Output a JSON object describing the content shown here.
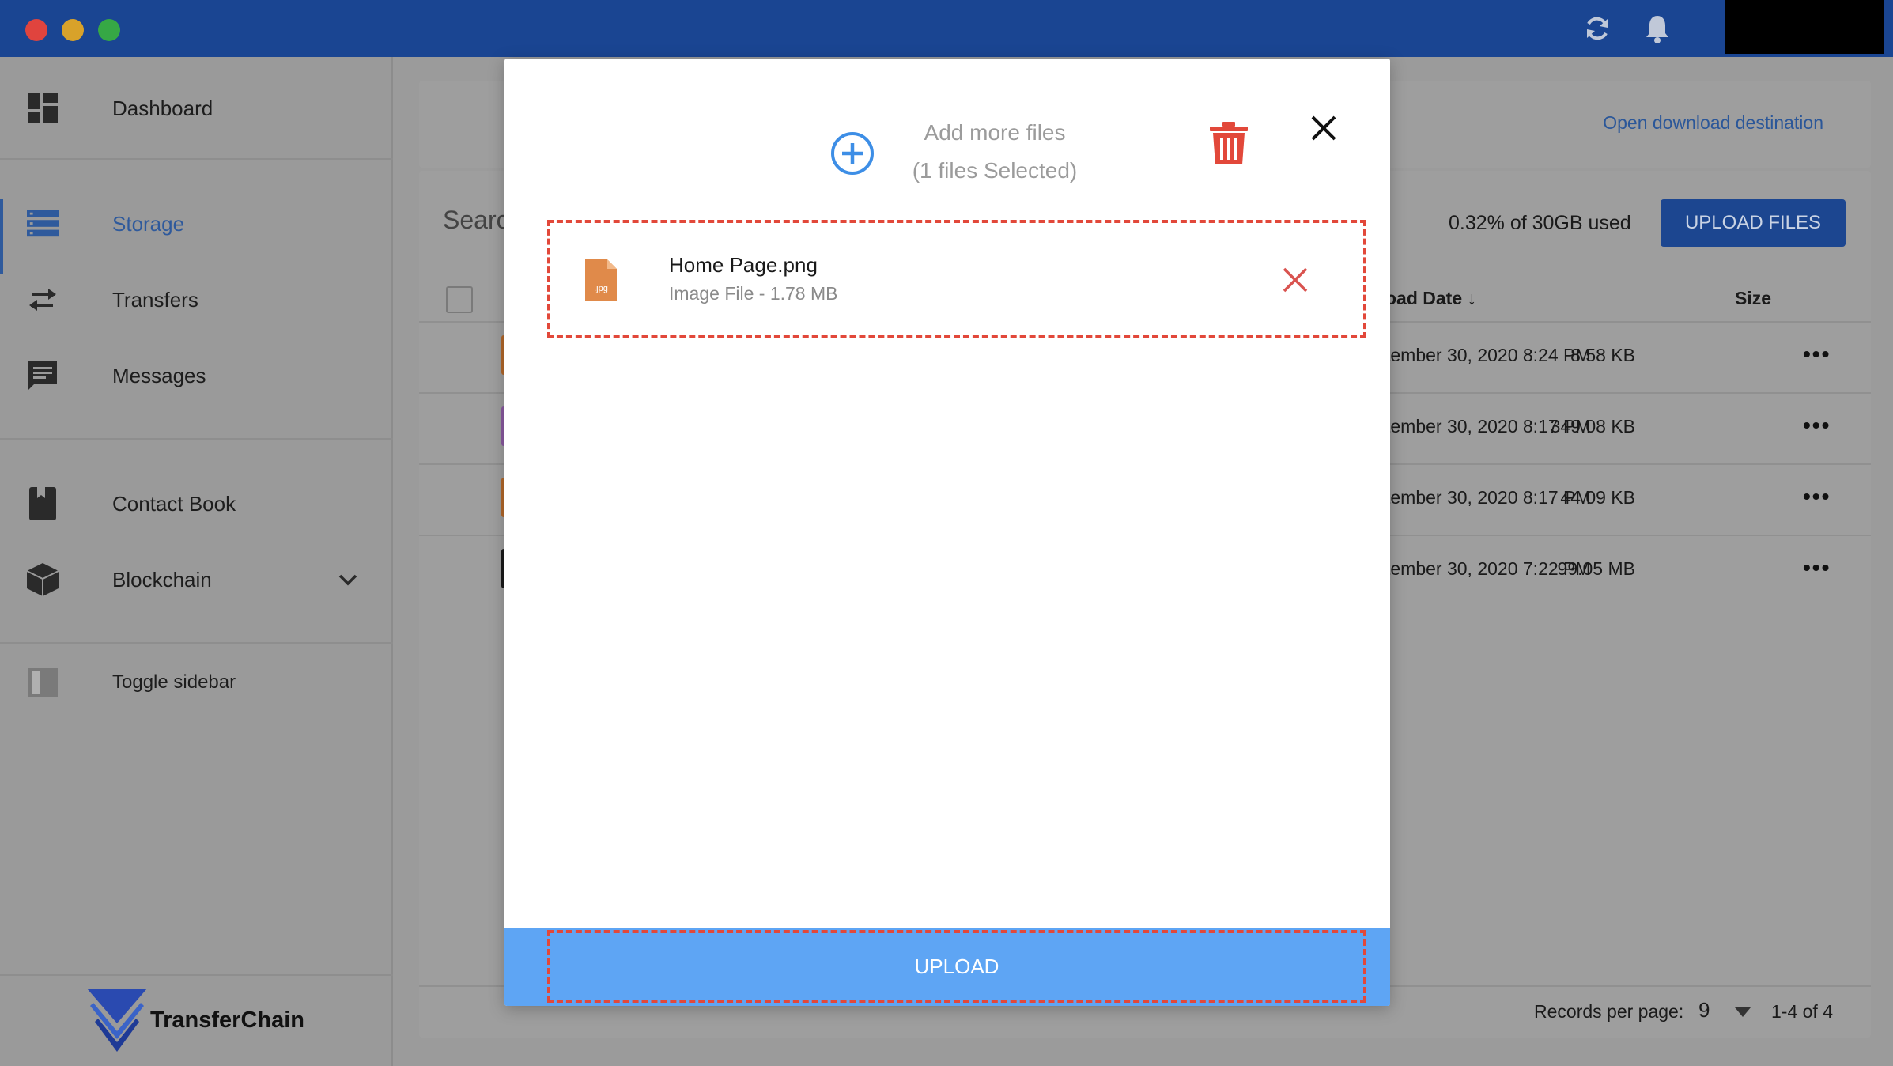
{
  "titlebar": {
    "icons": [
      "refresh-icon",
      "bell-icon"
    ]
  },
  "sidebar": {
    "items": [
      {
        "label": "Dashboard",
        "icon": "dashboard-icon"
      },
      {
        "label": "Storage",
        "icon": "storage-icon",
        "active": true
      },
      {
        "label": "Transfers",
        "icon": "transfers-icon"
      },
      {
        "label": "Messages",
        "icon": "messages-icon"
      },
      {
        "label": "Contact Book",
        "icon": "book-icon"
      },
      {
        "label": "Blockchain",
        "icon": "blockchain-icon"
      },
      {
        "label": "Toggle sidebar",
        "icon": "toggle-sidebar-icon"
      }
    ],
    "brand": "TransferChain"
  },
  "main": {
    "open_download_destination": "Open download destination",
    "search_placeholder": "Searc",
    "storage_used": "0.32% of 30GB used",
    "upload_files_label": "UPLOAD FILES",
    "columns": {
      "date": "oad Date",
      "size": "Size"
    },
    "rows": [
      {
        "date": "tember 30, 2020 8:24 PM",
        "size": "8.58 KB",
        "chip": "#b3682a"
      },
      {
        "date": "tember 30, 2020 8:17 PM",
        "size": "349.08 KB",
        "chip": "#8a5aa0"
      },
      {
        "date": "tember 30, 2020 8:17 PM",
        "size": "44.09 KB",
        "chip": "#b3682a"
      },
      {
        "date": "tember 30, 2020 7:22 PM",
        "size": "99.05 MB",
        "chip": "#1a1a1a"
      }
    ],
    "more_label": "•••",
    "records_per_page_label": "Records per page:",
    "records_per_page_value": "9",
    "pagination": "1-4 of 4"
  },
  "modal": {
    "add_more_files": "Add more files",
    "files_selected": "(1 files Selected)",
    "file": {
      "name": "Home Page.png",
      "meta": "Image File - 1.78 MB",
      "badge": ".jpg"
    },
    "upload_label": "UPLOAD"
  },
  "colors": {
    "titlebar": "#1a4592",
    "accent": "#2f5a9c",
    "upload_bar": "#5ea5f4",
    "danger": "#e2483a",
    "add_icon": "#3d8ee6"
  }
}
